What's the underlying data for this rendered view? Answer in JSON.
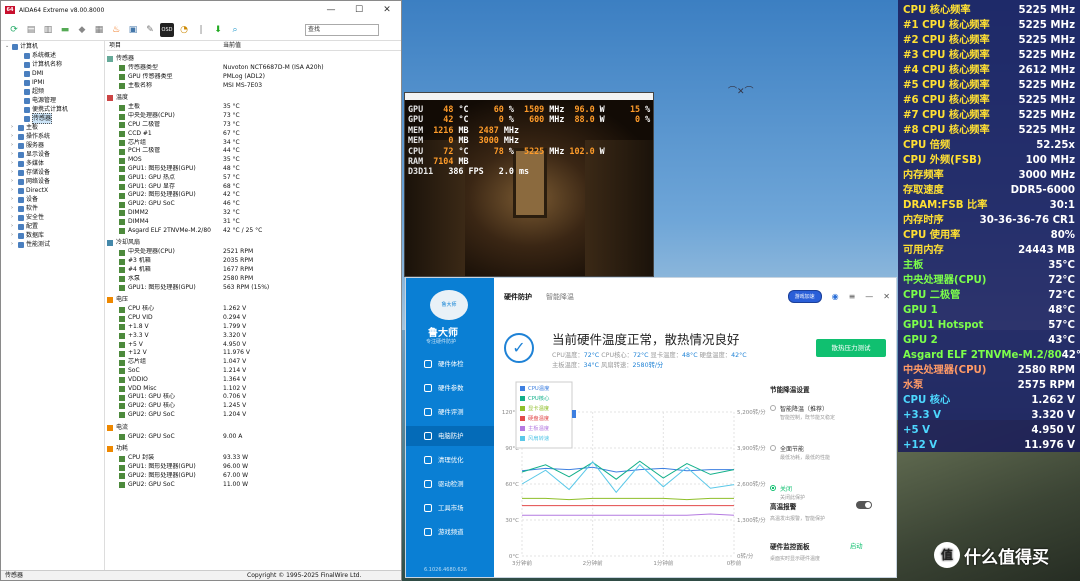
{
  "aida": {
    "title": "AIDA64 Extreme v8.00.8000",
    "search_value": "查找",
    "status_left": "传感器",
    "status_right": "Copyright © 1995-2025 FinalWire Ltd.",
    "tree": [
      {
        "label": "计算机",
        "level": 0
      },
      {
        "label": "系统概述",
        "level": 2
      },
      {
        "label": "计算机名称",
        "level": 2
      },
      {
        "label": "DMI",
        "level": 2
      },
      {
        "label": "IPMI",
        "level": 2
      },
      {
        "label": "超频",
        "level": 2
      },
      {
        "label": "电源管理",
        "level": 2
      },
      {
        "label": "便携式计算机",
        "level": 2
      },
      {
        "label": "传感器",
        "level": 2,
        "selected": true
      },
      {
        "label": "主板",
        "level": 1
      },
      {
        "label": "操作系统",
        "level": 1
      },
      {
        "label": "服务器",
        "level": 1
      },
      {
        "label": "显示设备",
        "level": 1
      },
      {
        "label": "多媒体",
        "level": 1
      },
      {
        "label": "存储设备",
        "level": 1
      },
      {
        "label": "网络设备",
        "level": 1
      },
      {
        "label": "DirectX",
        "level": 1
      },
      {
        "label": "设备",
        "level": 1
      },
      {
        "label": "软件",
        "level": 1
      },
      {
        "label": "安全性",
        "level": 1
      },
      {
        "label": "配置",
        "level": 1
      },
      {
        "label": "数据库",
        "level": 1
      },
      {
        "label": "性能测试",
        "level": 1
      }
    ],
    "col_item": "项目",
    "col_value": "当前值",
    "groups": [
      {
        "title": "传感器",
        "rows": [
          {
            "k": "传感器类型",
            "v": "Nuvoton NCT6687D-M  (ISA A20h)"
          },
          {
            "k": "GPU 传感器类型",
            "v": "PMLog  (ADL2)"
          },
          {
            "k": "主板名称",
            "v": "MSI MS-7E03"
          }
        ]
      },
      {
        "title": "温度",
        "rows": [
          {
            "k": "主板",
            "v": "35 °C"
          },
          {
            "k": "中央处理器(CPU)",
            "v": "73 °C"
          },
          {
            "k": "CPU 二极管",
            "v": "73 °C"
          },
          {
            "k": "CCD #1",
            "v": "67 °C"
          },
          {
            "k": "芯片组",
            "v": "34 °C"
          },
          {
            "k": "PCH 二极管",
            "v": "44 °C"
          },
          {
            "k": "MOS",
            "v": "35 °C"
          },
          {
            "k": "GPU1: 图形处理器(GPU)",
            "v": "48 °C"
          },
          {
            "k": "GPU1: GPU 热点",
            "v": "57 °C"
          },
          {
            "k": "GPU1: GPU 显存",
            "v": "68 °C"
          },
          {
            "k": "GPU2: 图形处理器(GPU)",
            "v": "42 °C"
          },
          {
            "k": "GPU2: GPU SoC",
            "v": "46 °C"
          },
          {
            "k": "DIMM2",
            "v": "32 °C"
          },
          {
            "k": "DIMM4",
            "v": "31 °C"
          },
          {
            "k": "Asgard ELF 2TNVMe-M.2/80",
            "v": "42 °C / 25 °C"
          }
        ]
      },
      {
        "title": "冷却风扇",
        "rows": [
          {
            "k": "中央处理器(CPU)",
            "v": "2521 RPM"
          },
          {
            "k": "#3 机箱",
            "v": "2035 RPM"
          },
          {
            "k": "#4 机箱",
            "v": "1677 RPM"
          },
          {
            "k": "水泵",
            "v": "2580 RPM"
          },
          {
            "k": "GPU1: 图形处理器(GPU)",
            "v": "563 RPM  (15%)"
          }
        ]
      },
      {
        "title": "电压",
        "rows": [
          {
            "k": "CPU 核心",
            "v": "1.262 V"
          },
          {
            "k": "CPU VID",
            "v": "0.294 V"
          },
          {
            "k": "+1.8 V",
            "v": "1.799 V"
          },
          {
            "k": "+3.3 V",
            "v": "3.320 V"
          },
          {
            "k": "+5 V",
            "v": "4.950 V"
          },
          {
            "k": "+12 V",
            "v": "11.976 V"
          },
          {
            "k": "芯片组",
            "v": "1.047 V"
          },
          {
            "k": "SoC",
            "v": "1.214 V"
          },
          {
            "k": "VDDIO",
            "v": "1.364 V"
          },
          {
            "k": "VDD Misc",
            "v": "1.102 V"
          },
          {
            "k": "GPU1: GPU 核心",
            "v": "0.706 V"
          },
          {
            "k": "GPU2: GPU 核心",
            "v": "1.245 V"
          },
          {
            "k": "GPU2: GPU SoC",
            "v": "1.204 V"
          }
        ]
      },
      {
        "title": "电流",
        "rows": [
          {
            "k": "GPU2: GPU SoC",
            "v": "9.00 A"
          }
        ]
      },
      {
        "title": "功耗",
        "rows": [
          {
            "k": "CPU 封装",
            "v": "93.33 W"
          },
          {
            "k": "GPU1: 图形处理器(GPU)",
            "v": "96.00 W"
          },
          {
            "k": "GPU2: 图形处理器(GPU)",
            "v": "67.00 W"
          },
          {
            "k": "GPU2: GPU SoC",
            "v": "11.00 W"
          }
        ]
      }
    ]
  },
  "game_osd": [
    [
      {
        "t": "GPU",
        "c": "l"
      },
      {
        "t": "    48",
        "c": "n"
      },
      {
        "t": " °C",
        "c": "w"
      },
      {
        "t": "     60",
        "c": "n"
      },
      {
        "t": " %",
        "c": "w"
      },
      {
        "t": "  1509",
        "c": "n"
      },
      {
        "t": " MHz",
        "c": "w"
      },
      {
        "t": "  96.0",
        "c": "n"
      },
      {
        "t": " W",
        "c": "w"
      },
      {
        "t": "     15",
        "c": "n"
      },
      {
        "t": " %",
        "c": "w"
      }
    ],
    [
      {
        "t": "GPU",
        "c": "l"
      },
      {
        "t": "    42",
        "c": "n"
      },
      {
        "t": " °C",
        "c": "w"
      },
      {
        "t": "      0",
        "c": "n"
      },
      {
        "t": " %",
        "c": "w"
      },
      {
        "t": "   600",
        "c": "n"
      },
      {
        "t": " MHz",
        "c": "w"
      },
      {
        "t": "  88.0",
        "c": "n"
      },
      {
        "t": " W",
        "c": "w"
      },
      {
        "t": "      0",
        "c": "n"
      },
      {
        "t": " %",
        "c": "w"
      }
    ],
    [
      {
        "t": "MEM",
        "c": "l"
      },
      {
        "t": "  1216",
        "c": "n"
      },
      {
        "t": " MB",
        "c": "w"
      },
      {
        "t": "  2487",
        "c": "n"
      },
      {
        "t": " MHz",
        "c": "w"
      }
    ],
    [
      {
        "t": "MEM",
        "c": "l"
      },
      {
        "t": "     0",
        "c": "n"
      },
      {
        "t": " MB",
        "c": "w"
      },
      {
        "t": "  3000",
        "c": "n"
      },
      {
        "t": " MHz",
        "c": "w"
      }
    ],
    [
      {
        "t": "CPU",
        "c": "l"
      },
      {
        "t": "    72",
        "c": "n"
      },
      {
        "t": " °C",
        "c": "w"
      },
      {
        "t": "     78",
        "c": "n"
      },
      {
        "t": " %",
        "c": "w"
      },
      {
        "t": "  5225",
        "c": "n"
      },
      {
        "t": " MHz",
        "c": "w"
      },
      {
        "t": " 102.0",
        "c": "n"
      },
      {
        "t": " W",
        "c": "w"
      }
    ],
    [
      {
        "t": "RAM",
        "c": "l"
      },
      {
        "t": "  7104",
        "c": "n"
      },
      {
        "t": " MB",
        "c": "w"
      }
    ],
    [
      {
        "t": "D3D11",
        "c": "l"
      },
      {
        "t": "   386",
        "c": "w"
      },
      {
        "t": " FPS",
        "c": "w"
      },
      {
        "t": "   2.0",
        "c": "w"
      },
      {
        "t": " ms",
        "c": "w"
      }
    ]
  ],
  "lds": {
    "brand": "鲁大师",
    "slogan": "专注硬件防护",
    "logo_text": "鲁大师",
    "version": "6.1026.4680.626",
    "nav": [
      "硬件体检",
      "硬件参数",
      "硬件评测",
      "电脑防护",
      "清理优化",
      "驱动检测",
      "工具市场",
      "游戏频道"
    ],
    "nav_selected": 3,
    "tab_on": "硬件防护",
    "tab_off": "智能降温",
    "badge": "游戏加速",
    "headline": "当前硬件温度正常，散热情况良好",
    "sub1": [
      {
        "t": "CPU温度：",
        "b": false
      },
      {
        "t": "72°C",
        "b": true
      },
      {
        "t": "   CPU核心：",
        "b": false
      },
      {
        "t": "72°C",
        "b": true
      },
      {
        "t": "   显卡温度：",
        "b": false
      },
      {
        "t": "48°C",
        "b": true
      },
      {
        "t": "   硬盘温度：",
        "b": false
      },
      {
        "t": "42°C",
        "b": true
      }
    ],
    "sub2": [
      {
        "t": "主板温度：",
        "b": false
      },
      {
        "t": "34°C",
        "b": true
      },
      {
        "t": "   风扇转速：",
        "b": false
      },
      {
        "t": "2580转/分",
        "b": true
      }
    ],
    "test_button": "散热压力测试",
    "cool_title": "节能降温设置",
    "options": [
      {
        "label": "智能降温（推荐）",
        "desc": "智能控制，既节能又稳定",
        "on": false
      },
      {
        "label": "全面节能",
        "desc": "最低功耗，最低的性能",
        "on": false
      },
      {
        "label": "关闭",
        "desc": "关闭此保护",
        "on": true
      }
    ],
    "alarm_title": "高温报警",
    "alarm_desc": "高温发出报警，智能保护",
    "monitor_title": "硬件监控面板",
    "monitor_action": "启动",
    "monitor_desc": "桌面实时显示硬件温度"
  },
  "chart_data": {
    "type": "line",
    "x_ticks": [
      "3分钟前",
      "2分钟前",
      "1分钟前",
      "0秒前"
    ],
    "y_left_ticks": [
      "0°C",
      "30°C",
      "60°C",
      "90°C",
      "120°C"
    ],
    "y_left_range": [
      0,
      120
    ],
    "y_right_ticks": [
      "0转/分",
      "1,300转/分",
      "2,600转/分",
      "3,900转/分",
      "5,200转/分"
    ],
    "y_right_range": [
      0,
      5200
    ],
    "grid": true,
    "legend_position": "top-left",
    "series": [
      {
        "name": "CPU温度",
        "color": "#3d7fe0",
        "axis": "left",
        "values": [
          71,
          73,
          72,
          74,
          70,
          72,
          73,
          71,
          72,
          72
        ]
      },
      {
        "name": "CPU核心",
        "color": "#12b08a",
        "axis": "left",
        "values": [
          70,
          76,
          66,
          78,
          64,
          79,
          65,
          77,
          68,
          72
        ]
      },
      {
        "name": "显卡温度",
        "color": "#8fbf2a",
        "axis": "left",
        "values": [
          48,
          48,
          47,
          48,
          48,
          48,
          48,
          47,
          48,
          48
        ]
      },
      {
        "name": "硬盘温度",
        "color": "#e24a4a",
        "axis": "left",
        "values": [
          42,
          42,
          42,
          42,
          42,
          42,
          42,
          42,
          42,
          42
        ]
      },
      {
        "name": "主板温度",
        "color": "#b47ae0",
        "axis": "left",
        "values": [
          34,
          34,
          34,
          34,
          34,
          34,
          34,
          34,
          35,
          34
        ]
      },
      {
        "name": "风扇转速",
        "color": "#5ac8e8",
        "axis": "right",
        "values": [
          2600,
          3100,
          2400,
          3400,
          2300,
          3300,
          2500,
          3200,
          2450,
          2580
        ]
      }
    ]
  },
  "overlay": {
    "key_color": "#ffe033",
    "warm_color": "#ff9a66",
    "rows": [
      {
        "k": "CPU 核心频率",
        "v": "5225 MHz",
        "warm": false
      },
      {
        "k": "#1 CPU 核心频率",
        "v": "5225 MHz",
        "warm": false
      },
      {
        "k": "#2 CPU 核心频率",
        "v": "5225 MHz",
        "warm": false
      },
      {
        "k": "#3 CPU 核心频率",
        "v": "5225 MHz",
        "warm": false
      },
      {
        "k": "#4 CPU 核心频率",
        "v": "2612 MHz",
        "warm": false
      },
      {
        "k": "#5 CPU 核心频率",
        "v": "5225 MHz",
        "warm": false
      },
      {
        "k": "#6 CPU 核心频率",
        "v": "5225 MHz",
        "warm": false
      },
      {
        "k": "#7 CPU 核心频率",
        "v": "5225 MHz",
        "warm": false
      },
      {
        "k": "#8 CPU 核心频率",
        "v": "5225 MHz",
        "warm": false
      },
      {
        "k": "CPU 倍频",
        "v": "52.25x",
        "warm": false
      },
      {
        "k": "CPU 外频(FSB)",
        "v": "100 MHz",
        "warm": false
      },
      {
        "k": "内存频率",
        "v": "3000 MHz",
        "warm": false
      },
      {
        "k": "存取速度",
        "v": "DDR5-6000",
        "warm": false
      },
      {
        "k": "DRAM:FSB 比率",
        "v": "30:1",
        "warm": false
      },
      {
        "k": "内存时序",
        "v": "30-36-36-76 CR1",
        "warm": false
      },
      {
        "k": "CPU 使用率",
        "v": "80%",
        "warm": false
      },
      {
        "k": "可用内存",
        "v": "24443 MB",
        "warm": false
      },
      {
        "k": "主板",
        "v": "35°C",
        "warm": false,
        "green": true
      },
      {
        "k": "中央处理器(CPU)",
        "v": "72°C",
        "warm": false,
        "green": true
      },
      {
        "k": "CPU 二极管",
        "v": "72°C",
        "warm": false,
        "green": true
      },
      {
        "k": "GPU 1",
        "v": "48°C",
        "warm": false,
        "green": true
      },
      {
        "k": "GPU1 Hotspot",
        "v": "57°C",
        "warm": false,
        "green": true
      },
      {
        "k": "GPU 2",
        "v": "43°C",
        "warm": false,
        "green": true
      },
      {
        "k": "Asgard ELF 2TNVMe-M.2/80",
        "v": "42°C",
        "warm": false,
        "green": true
      },
      {
        "k": "中央处理器(CPU)",
        "v": "2580 RPM",
        "warm": true
      },
      {
        "k": "水泵",
        "v": "2575 RPM",
        "warm": true
      },
      {
        "k": "CPU 核心",
        "v": "1.262 V",
        "warm": false,
        "cyan": true
      },
      {
        "k": "+3.3 V",
        "v": "3.320 V",
        "warm": false,
        "cyan": true
      },
      {
        "k": "+5 V",
        "v": "4.950 V",
        "warm": false,
        "cyan": true
      },
      {
        "k": "+12 V",
        "v": "11.976 V",
        "warm": false,
        "cyan": true
      }
    ]
  },
  "watermark": {
    "icon": "值",
    "text": "什么值得买"
  }
}
